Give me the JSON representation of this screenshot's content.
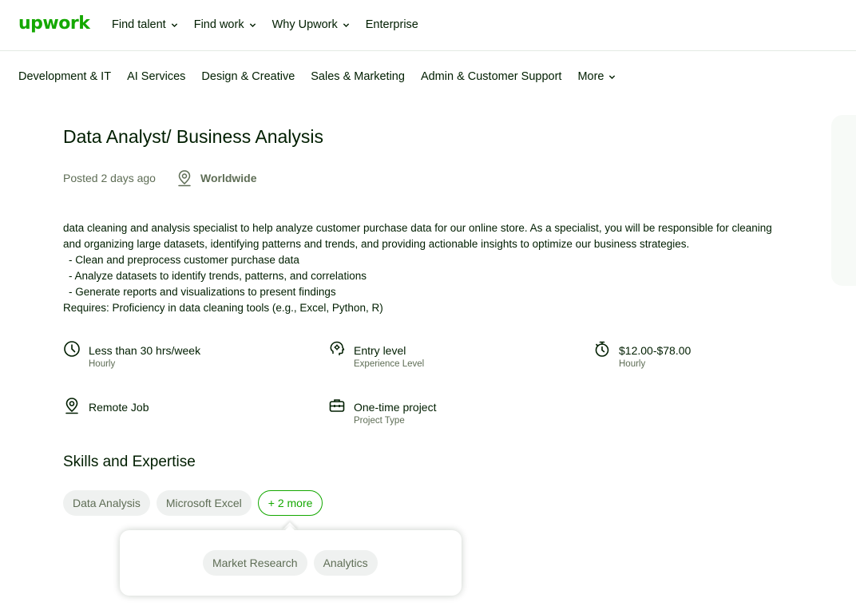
{
  "header": {
    "logo": "upwork",
    "nav": [
      {
        "label": "Find talent",
        "dropdown": true
      },
      {
        "label": "Find work",
        "dropdown": true
      },
      {
        "label": "Why Upwork",
        "dropdown": true
      },
      {
        "label": "Enterprise",
        "dropdown": false
      }
    ]
  },
  "categories": {
    "items": [
      "Development & IT",
      "AI Services",
      "Design & Creative",
      "Sales & Marketing",
      "Admin & Customer Support"
    ],
    "more": "More"
  },
  "job": {
    "title": "Data Analyst/ Business Analysis",
    "posted": "Posted 2 days ago",
    "location": "Worldwide",
    "description": [
      "data cleaning and analysis specialist to help analyze customer purchase data for our online store. As a specialist, you will be responsible for cleaning",
      "and organizing large datasets, identifying patterns and trends, and providing actionable insights to optimize our business strategies.",
      " - Clean and preprocess customer purchase data",
      " - Analyze datasets to identify trends, patterns, and correlations",
      " - Generate reports and visualizations to present findings",
      "Requires:  Proficiency in data cleaning tools (e.g., Excel, Python, R)"
    ]
  },
  "features": {
    "hours": {
      "title": "Less than 30 hrs/week",
      "sub": "Hourly",
      "icon": "clock-icon"
    },
    "level": {
      "title": "Entry level",
      "sub": "Experience Level",
      "icon": "gear-brain-icon"
    },
    "rate": {
      "title": "$12.00-$78.00",
      "sub": "Hourly",
      "icon": "stopwatch-icon"
    },
    "remote": {
      "title": "Remote Job",
      "icon": "location-pin-icon"
    },
    "project": {
      "title": "One-time project",
      "sub": "Project Type",
      "icon": "briefcase-icon"
    }
  },
  "skills": {
    "heading": "Skills and Expertise",
    "chips": [
      "Data Analysis",
      "Microsoft Excel"
    ],
    "more_label": "+ 2 more",
    "popover_chips": [
      "Market Research",
      "Analytics"
    ]
  },
  "colors": {
    "brand": "#14a800",
    "text": "#001e00",
    "muted": "#5e6d55",
    "chip_bg": "#eff1f0"
  }
}
